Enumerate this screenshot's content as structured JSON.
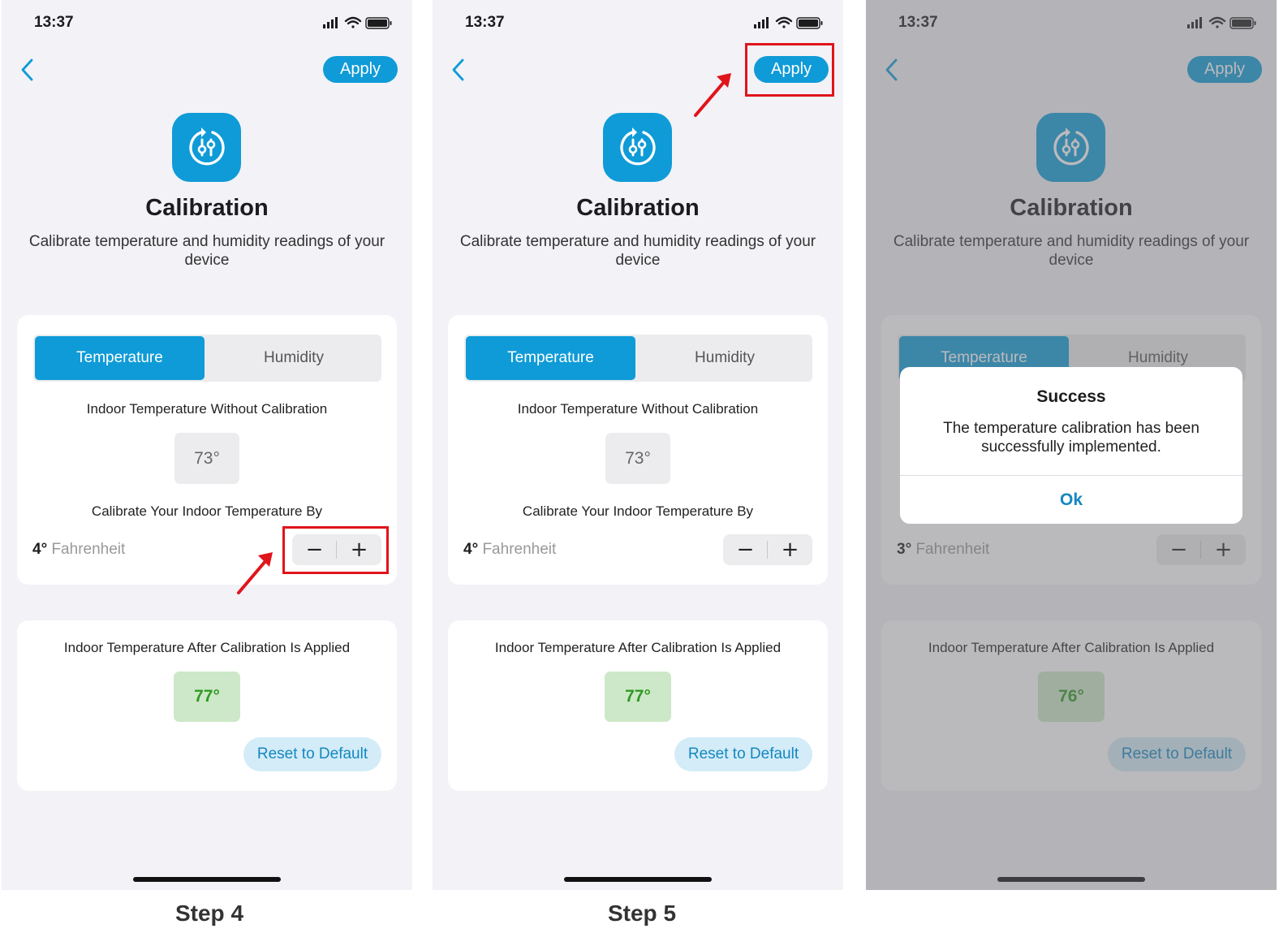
{
  "screens": [
    {
      "status_time": "13:37",
      "apply_label": "Apply",
      "title": "Calibration",
      "subtitle": "Calibrate temperature and humidity readings of your device",
      "tabs": {
        "temperature": "Temperature",
        "humidity": "Humidity"
      },
      "without_label": "Indoor Temperature Without Calibration",
      "without_value": "73°",
      "calibrate_label": "Calibrate Your Indoor Temperature By",
      "offset_value": "4°",
      "offset_unit": "Fahrenheit",
      "minus": "−",
      "plus": "+",
      "after_label": "Indoor Temperature After Calibration Is Applied",
      "after_value": "77°",
      "reset_label": "Reset to Default"
    },
    {
      "status_time": "13:37",
      "apply_label": "Apply",
      "title": "Calibration",
      "subtitle": "Calibrate temperature and humidity readings of your device",
      "tabs": {
        "temperature": "Temperature",
        "humidity": "Humidity"
      },
      "without_label": "Indoor Temperature Without Calibration",
      "without_value": "73°",
      "calibrate_label": "Calibrate Your Indoor Temperature By",
      "offset_value": "4°",
      "offset_unit": "Fahrenheit",
      "minus": "−",
      "plus": "+",
      "after_label": "Indoor Temperature After Calibration Is Applied",
      "after_value": "77°",
      "reset_label": "Reset to Default"
    },
    {
      "status_time": "13:37",
      "apply_label": "Apply",
      "title": "Calibration",
      "subtitle": "Calibrate temperature and humidity readings of your device",
      "tabs": {
        "temperature": "Temperature",
        "humidity": "Humidity"
      },
      "offset_value": "3°",
      "offset_unit": "Fahrenheit",
      "minus": "−",
      "plus": "+",
      "after_label": "Indoor Temperature After Calibration Is Applied",
      "after_value": "76°",
      "reset_label": "Reset to Default",
      "dialog": {
        "title": "Success",
        "message": "The temperature calibration has been successfully implemented.",
        "ok_label": "Ok"
      }
    }
  ],
  "step_labels": {
    "step4": "Step 4",
    "step5": "Step 5"
  },
  "colors": {
    "accent": "#0f9bd7",
    "background": "#f2f2f7",
    "success_bg": "#cde8c8",
    "success_text": "#2f9a23",
    "highlight": "#e0141b"
  },
  "icons": [
    "back-chevron-icon",
    "signal-icon",
    "wifi-icon",
    "battery-icon",
    "calibration-icon",
    "arrow-annotation-icon"
  ]
}
